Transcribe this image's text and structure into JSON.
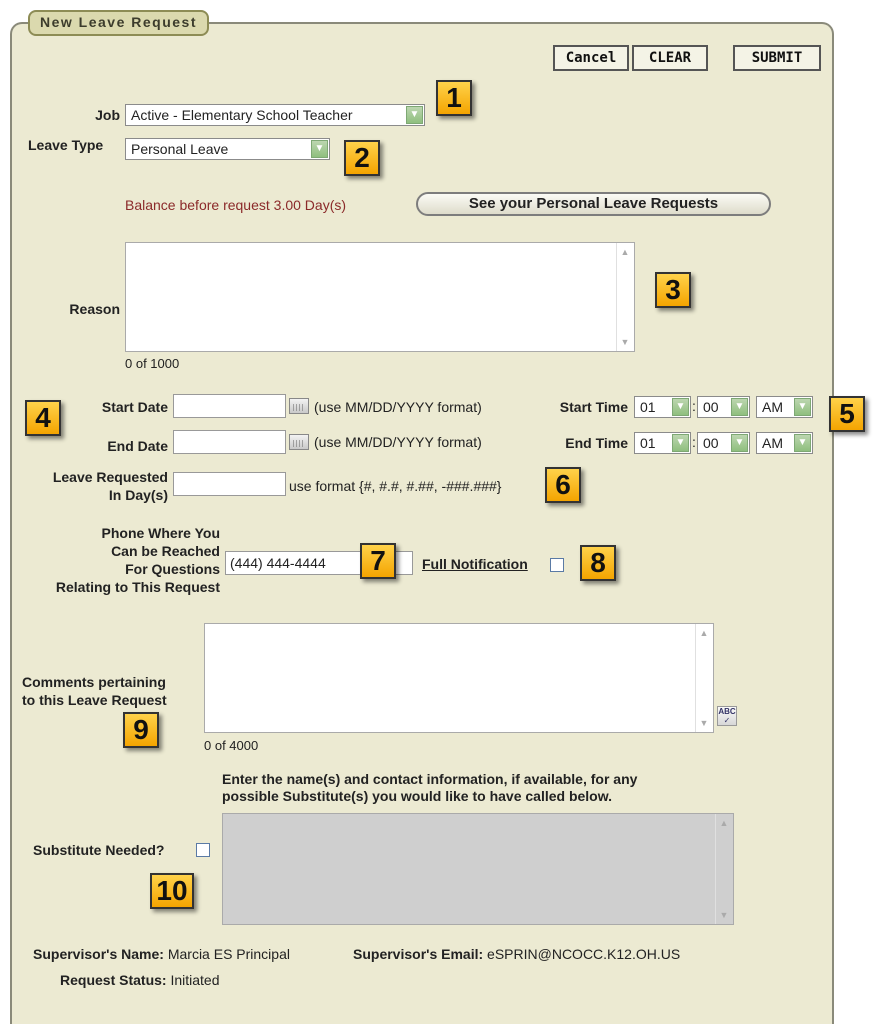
{
  "window": {
    "title": "New Leave Request"
  },
  "toolbar": {
    "cancel": "Cancel",
    "clear": "CLEAR",
    "submit": "SUBMIT"
  },
  "job": {
    "label": "Job",
    "value": "Active - Elementary School Teacher"
  },
  "leave_type": {
    "label": "Leave Type",
    "value": "Personal Leave"
  },
  "balance": {
    "text": "Balance before request 3.00 Day(s)",
    "button": "See your Personal Leave Requests"
  },
  "reason": {
    "label": "Reason",
    "counter": "0 of 1000"
  },
  "start_date": {
    "label": "Start Date",
    "hint": "(use MM/DD/YYYY format)"
  },
  "end_date": {
    "label": "End Date",
    "hint": "(use MM/DD/YYYY format)"
  },
  "start_time": {
    "label": "Start Time",
    "hour": "01",
    "minute": "00",
    "ampm": "AM"
  },
  "end_time": {
    "label": "End Time",
    "hour": "01",
    "minute": "00",
    "ampm": "AM"
  },
  "time_separator": ":",
  "days": {
    "label_line1": "Leave Requested",
    "label_line2": "In Day(s)",
    "hint": "use format {#, #.#, #.##, -###.###}"
  },
  "phone": {
    "label_line1": "Phone Where You",
    "label_line2": "Can be Reached",
    "label_line3": "For Questions",
    "label_line4": "Relating to This Request",
    "value": "(444) 444-4444"
  },
  "notification": {
    "label": "Full Notification"
  },
  "comments": {
    "label_line1": "Comments pertaining",
    "label_line2": "to this Leave Request",
    "counter": "0 of 4000"
  },
  "substitute": {
    "instruction_line1": "Enter the name(s) and contact information, if available, for any",
    "instruction_line2": "possible Substitute(s) you would like to have called below.",
    "label": "Substitute Needed?"
  },
  "supervisor": {
    "name_label": "Supervisor's Name:",
    "name": "Marcia ES Principal",
    "email_label": "Supervisor's Email:",
    "email": "eSPRIN@NCOCC.K12.OH.US"
  },
  "status": {
    "label": "Request Status:",
    "value": "Initiated"
  },
  "badges": [
    "1",
    "2",
    "3",
    "4",
    "5",
    "6",
    "7",
    "8",
    "9",
    "10"
  ],
  "colors": {
    "panel": "#ecead2",
    "badge": "#f7b722",
    "maroon": "#8b2a2a",
    "select_arrow": "#8fbf7e"
  }
}
